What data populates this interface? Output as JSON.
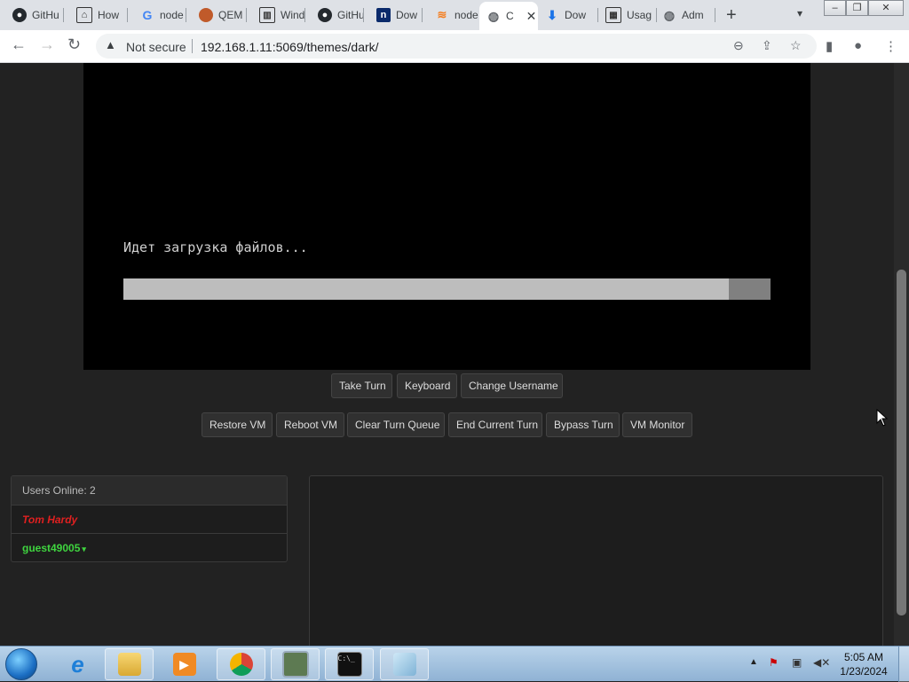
{
  "browser": {
    "tabs": [
      {
        "title": "GitHu",
        "icon": "github-icon"
      },
      {
        "title": "How",
        "icon": "howto-icon"
      },
      {
        "title": "node",
        "icon": "google-icon"
      },
      {
        "title": "QEM",
        "icon": "qemu-icon"
      },
      {
        "title": "Wind",
        "icon": "windows-docs-icon"
      },
      {
        "title": "GitHu",
        "icon": "github-icon"
      },
      {
        "title": "Dow",
        "icon": "n-icon"
      },
      {
        "title": "node",
        "icon": "stackoverflow-icon"
      },
      {
        "title": "C",
        "icon": "globe-icon",
        "active": true
      },
      {
        "title": "Dow",
        "icon": "download-icon"
      },
      {
        "title": "Usag",
        "icon": "docs-icon"
      },
      {
        "title": "Adm",
        "icon": "globe-icon"
      }
    ],
    "security_label": "Not secure",
    "url": "192.168.1.11:5069/themes/dark/"
  },
  "vm": {
    "console_text": "Идет загрузка файлов...",
    "progress_fraction": 0.935
  },
  "controls": {
    "row1": [
      "Take Turn",
      "Keyboard",
      "Change Username"
    ],
    "row2": [
      "Restore VM",
      "Reboot VM",
      "Clear Turn Queue",
      "End Current Turn",
      "Bypass Turn",
      "VM Monitor"
    ]
  },
  "users": {
    "header": "Users Online: 2",
    "list": [
      {
        "name": "Tom Hardy",
        "color": "#e02020"
      },
      {
        "name": "guest49005",
        "color": "#3fd43f"
      }
    ]
  },
  "taskbar": {
    "apps": [
      "windows-explorer-icon",
      "internet-explorer-icon",
      "file-explorer-icon",
      "media-player-icon",
      "chrome-icon",
      "vm-manager-icon",
      "command-prompt-icon",
      "notepad-icon"
    ],
    "time": "5:05 AM",
    "date": "1/23/2024"
  }
}
